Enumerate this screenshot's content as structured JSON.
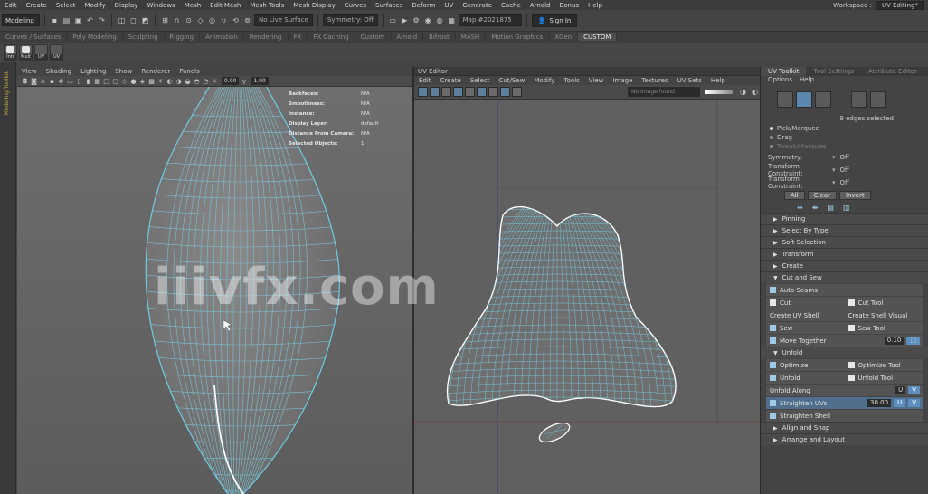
{
  "menubar": {
    "items": [
      "Edit",
      "Create",
      "Select",
      "Modify",
      "Display",
      "Windows",
      "Mesh",
      "Edit Mesh",
      "Mesh Tools",
      "Mesh Display",
      "Curves",
      "Surfaces",
      "Deform",
      "UV",
      "Generate",
      "Cache",
      "Arnold",
      "Bonus",
      "Help"
    ],
    "workspace_label": "Workspace :",
    "workspace_value": "UV Editing*"
  },
  "statusline": {
    "mode": "Modeling",
    "live_surface": "No Live Surface",
    "symmetry": "Symmetry: Off",
    "search_placeholder": "Map #2021875",
    "sign_in": "Sign In"
  },
  "shelf_tabs": [
    "Curves / Surfaces",
    "Poly Modeling",
    "Sculpting",
    "Rigging",
    "Animation",
    "Rendering",
    "FX",
    "FX Caching",
    "Custom",
    "Arnold",
    "Bifrost",
    "MASH",
    "Motion Graphics",
    "XGen",
    "CUSTOM"
  ],
  "shelf_tab_active": 14,
  "shelf_icons": [
    "Intr",
    "Mult",
    "UV",
    "UV"
  ],
  "left_strip_label": "Modeling Toolkit",
  "viewport": {
    "menus": [
      "View",
      "Shading",
      "Lighting",
      "Show",
      "Renderer",
      "Panels"
    ],
    "near_value": "0.00",
    "far_value": "1.00",
    "hud": [
      {
        "k": "Backfaces:",
        "v": "N/A"
      },
      {
        "k": "Smoothness:",
        "v": "N/A"
      },
      {
        "k": "Instance:",
        "v": "N/A"
      },
      {
        "k": "Display Layer:",
        "v": "default"
      },
      {
        "k": "Distance From Camera:",
        "v": "N/A"
      },
      {
        "k": "Selected Objects:",
        "v": "1"
      }
    ]
  },
  "uv_editor": {
    "title": "UV Editor",
    "menus": [
      "Edit",
      "Create",
      "Select",
      "Cut/Sew",
      "Modify",
      "Tools",
      "View",
      "Image",
      "Textures",
      "UV Sets",
      "Help"
    ],
    "image_field_placeholder": "No Image found"
  },
  "right_panel": {
    "tabs": [
      "UV Toolkit",
      "Tool Settings",
      "Attribute Editor"
    ],
    "active_tab": 0,
    "menus": [
      "Options",
      "Help"
    ],
    "selection_info": "9 edges selected",
    "pick_options": [
      "Pick/Marquee",
      "Drag",
      "Tweak/Marquee"
    ],
    "symmetry_label": "Symmetry:",
    "symmetry_value": "Off",
    "shell_constraint_1": "Transform Constraint:",
    "shell_constraint_1_value": "Off",
    "shell_constraint_2": "Transform Constraint:",
    "shell_constraint_2_value": "Off",
    "buttons": [
      "All",
      "Clear",
      "Invert"
    ],
    "sections_top": [
      "Pinning",
      "Select By Type",
      "Soft Selection",
      "Transform",
      "Create",
      "Cut and Sew"
    ],
    "cut_tools": [
      {
        "left": "Auto Seams",
        "right": ""
      },
      {
        "left": "Cut",
        "right": "Cut Tool"
      },
      {
        "left": "Create UV Shell",
        "right": "Create Shell Visual"
      },
      {
        "left": "Sew",
        "right": "Sew Tool"
      },
      {
        "left": "Move Together",
        "right": "0.10"
      }
    ],
    "unfold_label": "Unfold",
    "unfold_tools": [
      {
        "left": "Optimize",
        "right": "Optimize Tool"
      },
      {
        "left": "Unfold",
        "right": "Unfold Tool"
      },
      {
        "left": "Unfold Along",
        "right": "U"
      },
      {
        "left": "Straighten UVs",
        "right": "30.00"
      },
      {
        "left": "Straighten Shell",
        "right": ""
      }
    ],
    "sections_bottom": [
      "Align and Snap",
      "Arrange and Layout"
    ]
  },
  "watermark": "iiivfx.com"
}
